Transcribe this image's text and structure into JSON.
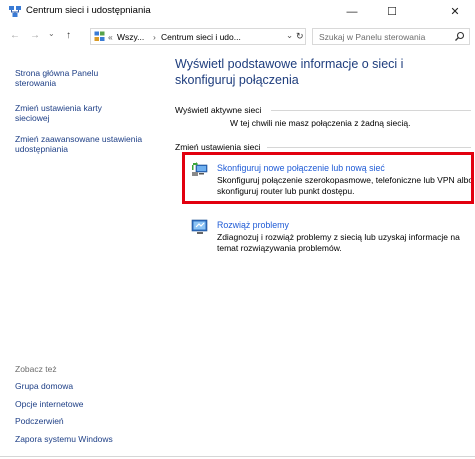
{
  "window": {
    "title": "Centrum sieci i udostępniania",
    "minimize": "—",
    "maximize": "☐",
    "close": "✕"
  },
  "nav": {
    "back": "←",
    "forward": "→",
    "dropdown": "⌄",
    "up": "↑",
    "breadcrumb": [
      "«",
      "Wszy...",
      "›",
      "Centrum sieci i udo..."
    ],
    "address_dropdown": "⌄",
    "refresh": "↻",
    "search_placeholder": "Szukaj w Panelu sterowania"
  },
  "sidebar": {
    "links": [
      "Strona główna Panelu sterowania",
      "Zmień ustawienia karty sieciowej",
      "Zmień zaawansowane ustawienia udostępniania"
    ],
    "see_also_title": "Zobacz też",
    "see_also": [
      "Grupa domowa",
      "Opcje internetowe",
      "Podczerwień",
      "Zapora systemu Windows"
    ]
  },
  "main": {
    "heading": "Wyświetl podstawowe informacje o sieci i skonfiguruj połączenia",
    "active_networks_label": "Wyświetl aktywne sieci",
    "no_connection": "W tej chwili nie masz połączenia z żadną siecią.",
    "change_settings_label": "Zmień ustawienia sieci",
    "tasks": [
      {
        "icon": "network-setup-icon",
        "title": "Skonfiguruj nowe połączenie lub nową sieć",
        "description": "Skonfiguruj połączenie szerokopasmowe, telefoniczne lub VPN albo skonfiguruj router lub punkt dostępu."
      },
      {
        "icon": "troubleshoot-icon",
        "title": "Rozwiąż problemy",
        "description": "Zdiagnozuj i rozwiąż problemy z siecią lub uzyskaj informacje na temat rozwiązywania problemów."
      }
    ]
  },
  "colors": {
    "link": "#1f5bd6",
    "sidebar_link": "#1e3f86",
    "heading": "#1e3d7d",
    "highlight": "#e2000f"
  }
}
